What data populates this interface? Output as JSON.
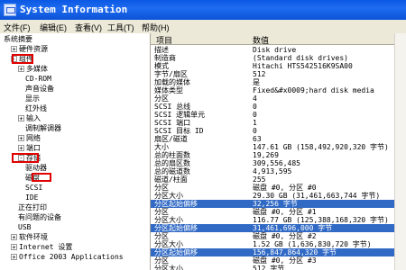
{
  "window": {
    "title": "System Information"
  },
  "menu": [
    {
      "label": "文件(F)"
    },
    {
      "label": "编辑(E)"
    },
    {
      "label": "查看(V)"
    },
    {
      "label": "工具(T)"
    },
    {
      "label": "帮助(H)"
    }
  ],
  "tree": [
    {
      "label": "系统摘要",
      "indent": 0,
      "expander": ""
    },
    {
      "label": "硬件资源",
      "indent": 1,
      "expander": "+"
    },
    {
      "label": "组件",
      "indent": 1,
      "expander": "-"
    },
    {
      "label": "多媒体",
      "indent": 2,
      "expander": "+"
    },
    {
      "label": "CD-ROM",
      "indent": 3,
      "expander": ""
    },
    {
      "label": "声音设备",
      "indent": 3,
      "expander": ""
    },
    {
      "label": "显示",
      "indent": 3,
      "expander": ""
    },
    {
      "label": "红外线",
      "indent": 3,
      "expander": ""
    },
    {
      "label": "输入",
      "indent": 2,
      "expander": "+"
    },
    {
      "label": "调制解调器",
      "indent": 3,
      "expander": ""
    },
    {
      "label": "网络",
      "indent": 2,
      "expander": "+"
    },
    {
      "label": "端口",
      "indent": 2,
      "expander": "+"
    },
    {
      "label": "存储",
      "indent": 2,
      "expander": "-"
    },
    {
      "label": "驱动器",
      "indent": 3,
      "expander": ""
    },
    {
      "label": "磁盘",
      "indent": 3,
      "expander": ""
    },
    {
      "label": "SCSI",
      "indent": 3,
      "expander": ""
    },
    {
      "label": "IDE",
      "indent": 3,
      "expander": ""
    },
    {
      "label": "正在打印",
      "indent": 2,
      "expander": ""
    },
    {
      "label": "有问题的设备",
      "indent": 2,
      "expander": ""
    },
    {
      "label": "USB",
      "indent": 2,
      "expander": ""
    },
    {
      "label": "软件环境",
      "indent": 1,
      "expander": "+"
    },
    {
      "label": "Internet 设置",
      "indent": 1,
      "expander": "+"
    },
    {
      "label": "Office 2003 Applications",
      "indent": 1,
      "expander": "+"
    }
  ],
  "table": {
    "headers": {
      "item": "项目",
      "value": "数值"
    },
    "rows": [
      {
        "k": "描述",
        "v": "Disk drive"
      },
      {
        "k": "制造商",
        "v": "(Standard disk drives)"
      },
      {
        "k": "模式",
        "v": "Hitachi HTS542516K9SA00"
      },
      {
        "k": "字节/扇区",
        "v": "512"
      },
      {
        "k": "加载的媒体",
        "v": "是"
      },
      {
        "k": "媒体类型",
        "v": "Fixed&#x0009;hard disk media"
      },
      {
        "k": "分区",
        "v": "4"
      },
      {
        "k": "SCSI 总线",
        "v": "0"
      },
      {
        "k": "SCSI 逻辑单元",
        "v": "0"
      },
      {
        "k": "SCSI 端口",
        "v": "1"
      },
      {
        "k": "SCSI 目标 ID",
        "v": "0"
      },
      {
        "k": "扇区/磁道",
        "v": "63"
      },
      {
        "k": "大小",
        "v": "147.61 GB (158,492,920,320 字节)"
      },
      {
        "k": "总的柱面数",
        "v": "19,269"
      },
      {
        "k": "总的扇区数",
        "v": "309,556,485"
      },
      {
        "k": "总的磁道数",
        "v": "4,913,595"
      },
      {
        "k": "磁道/柱面",
        "v": "255"
      },
      {
        "k": "分区",
        "v": "磁盘 #0, 分区 #0"
      },
      {
        "k": "分区大小",
        "v": "29.30 GB (31,461,663,744 字节)"
      },
      {
        "k": "分区起始偏移",
        "v": "32,256 字节",
        "selected": true
      },
      {
        "k": "分区",
        "v": "磁盘 #0, 分区 #1"
      },
      {
        "k": "分区大小",
        "v": "116.77 GB (125,388,168,320 字节)"
      },
      {
        "k": "分区起始偏移",
        "v": "31,461,696,000 字节",
        "selected": true
      },
      {
        "k": "分区",
        "v": "磁盘 #0, 分区 #2"
      },
      {
        "k": "分区大小",
        "v": "1.52 GB (1,636,830,720 字节)"
      },
      {
        "k": "分区起始偏移",
        "v": "156,847,864,320 字节",
        "selected": true
      },
      {
        "k": "分区",
        "v": "磁盘 #0, 分区 #3"
      },
      {
        "k": "分区大小",
        "v": "512 字节"
      }
    ]
  }
}
